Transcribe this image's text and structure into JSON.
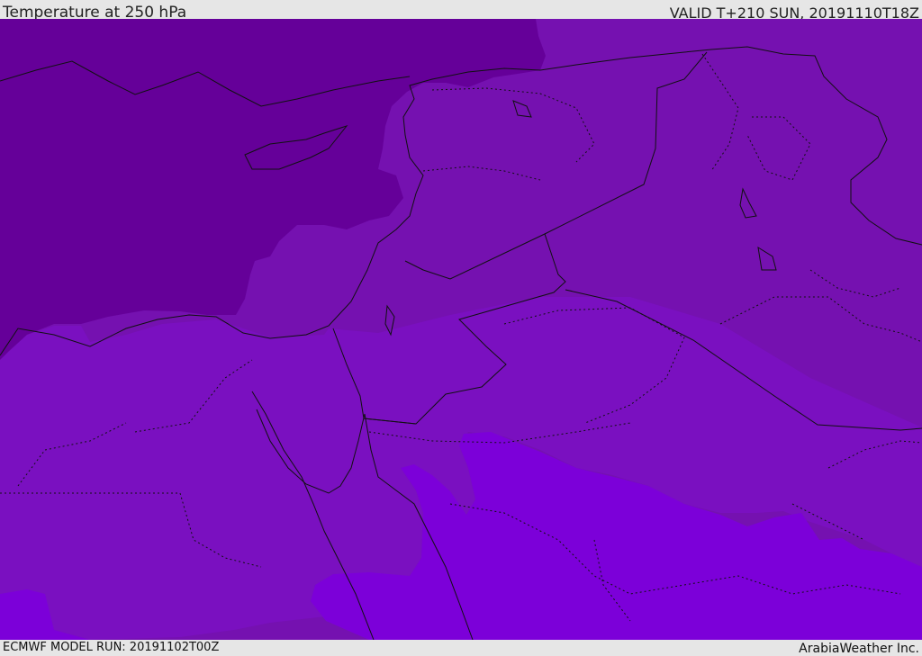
{
  "header": {
    "title": "Temperature at 250 hPa",
    "valid_time": "VALID T+210 SUN, 20191110T18Z"
  },
  "footer": {
    "model_run": "ECMWF MODEL RUN: 20191102T00Z",
    "credit": "ArabiaWeather Inc."
  },
  "map": {
    "palette": {
      "coldest": "#650099",
      "mid": "#7511b0",
      "mid_south": "#7a10c0",
      "warm": "#7c00d9",
      "border_line": "#111111"
    }
  }
}
